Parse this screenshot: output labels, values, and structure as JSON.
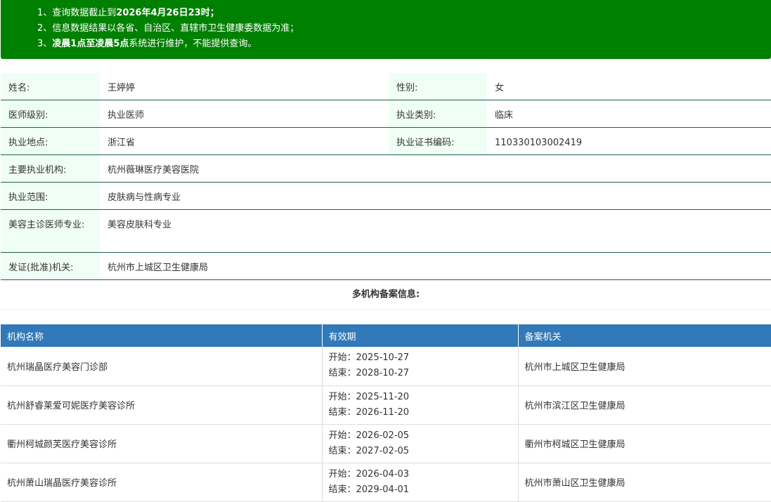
{
  "notice": {
    "line1_prefix": "1、查询数据截止到",
    "line1_bold": "2026年4月26日23时",
    "line1_suffix": "；",
    "line2": "2、信息数据结果以各省、自治区、直辖市卫生健康委数据为准；",
    "line3_prefix": "3、",
    "line3_bold": "凌晨1点至凌晨5点",
    "line3_suffix": "系统进行维护，不能提供查询。"
  },
  "doctor": {
    "name_label": "姓名:",
    "name": "王婷婷",
    "gender_label": "性别:",
    "gender": "女",
    "level_label": "医师级别:",
    "level": "执业医师",
    "category_label": "执业类别:",
    "category": "临床",
    "location_label": "执业地点:",
    "location": "浙江省",
    "cert_label": "执业证书编码:",
    "cert": "110330103002419",
    "institution_label": "主要执业机构:",
    "institution": "杭州薇琳医疗美容医院",
    "scope_label": "执业范围:",
    "scope": "皮肤病与性病专业",
    "beauty_label": "美容主诊医师专业:",
    "beauty": "美容皮肤科专业",
    "issuer_label": "发证(批准)机关:",
    "issuer": "杭州市上城区卫生健康局"
  },
  "multi": {
    "title": "多机构备案信息:",
    "headers": [
      "机构名称",
      "有效期",
      "备案机关"
    ],
    "rows": [
      {
        "name": "杭州瑞晶医疗美容门诊部",
        "start": "开始：2025-10-27",
        "end": "结束：2028-10-27",
        "authority": "杭州市上城区卫生健康局"
      },
      {
        "name": "杭州舒睿莱爱可妮医疗美容诊所",
        "start": "开始：2025-11-20",
        "end": "结束：2026-11-20",
        "authority": "杭州市滨江区卫生健康局"
      },
      {
        "name": "衢州柯城颜芙医疗美容诊所",
        "start": "开始：2026-02-05",
        "end": "结束：2027-02-05",
        "authority": "衢州市柯城区卫生健康局"
      },
      {
        "name": "杭州萧山瑞晶医疗美容诊所",
        "start": "开始：2026-04-03",
        "end": "结束：2029-04-01",
        "authority": "杭州市萧山区卫生健康局"
      }
    ]
  }
}
